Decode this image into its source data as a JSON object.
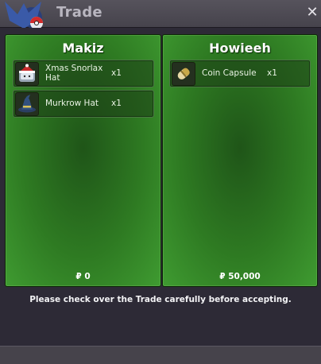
{
  "window": {
    "title": "Trade",
    "close_label": "✕"
  },
  "left": {
    "player": "Makiz",
    "items": [
      {
        "name": "Xmas Snorlax Hat",
        "qty": "x1",
        "icon": "xmas-snorlax-hat-icon"
      },
      {
        "name": "Murkrow Hat",
        "qty": "x1",
        "icon": "murkrow-hat-icon"
      }
    ],
    "money": "₽ 0"
  },
  "right": {
    "player": "Howieeh",
    "items": [
      {
        "name": "Coin Capsule",
        "qty": "x1",
        "icon": "coin-capsule-icon"
      }
    ],
    "money": "₽ 50,000"
  },
  "footer_note": "Please check over the Trade carefully before accepting.",
  "colors": {
    "panel_green": "#2e7a22",
    "window_bg": "#2d2a36",
    "titlebar": "#4d4a53"
  }
}
